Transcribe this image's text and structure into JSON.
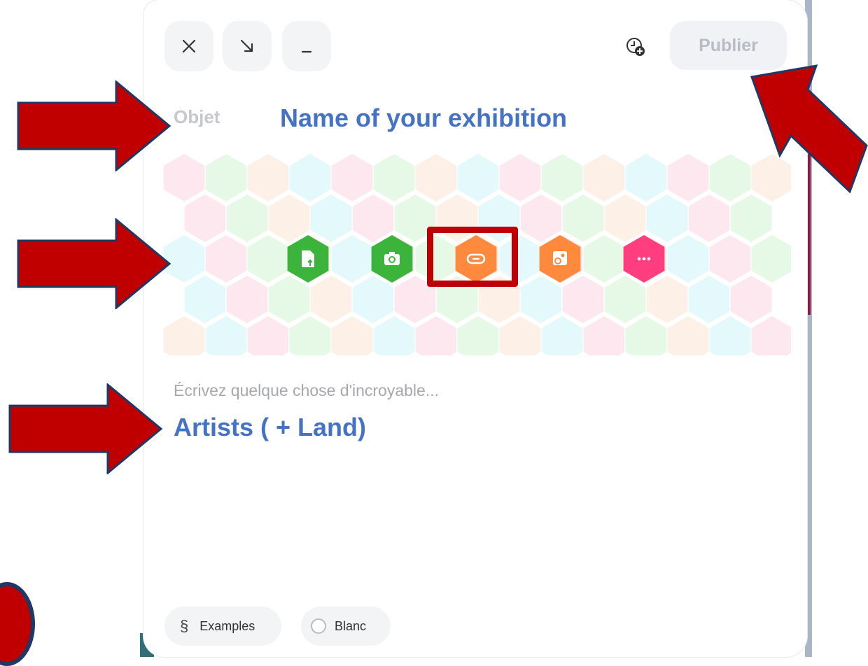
{
  "toolbar": {
    "close_icon": "close-icon",
    "shrink_icon": "arrow-down-right-icon",
    "minimize_icon": "minimize-icon",
    "schedule_icon": "clock-plus-icon",
    "publish_label": "Publier"
  },
  "form": {
    "subject_placeholder": "Objet",
    "body_placeholder": "Écrivez quelque chose d'incroyable..."
  },
  "annotations": {
    "title_note": "Name of your exhibition",
    "body_note": "Artists ( + Land)"
  },
  "media_buttons": [
    {
      "name": "upload-file-button",
      "icon": "file-upload-icon",
      "color": "#3cb43c"
    },
    {
      "name": "camera-button",
      "icon": "camera-icon",
      "color": "#3cb43c"
    },
    {
      "name": "link-button",
      "icon": "link-icon",
      "color": "#ff8a3d"
    },
    {
      "name": "image-search-button",
      "icon": "image-search-icon",
      "color": "#ff8a3d"
    },
    {
      "name": "more-button",
      "icon": "more-icon",
      "color": "#ff3d7f"
    }
  ],
  "footer": {
    "examples_label": "Examples",
    "examples_icon": "section-icon",
    "blank_label": "Blanc"
  },
  "colors": {
    "accent_text": "#4472c4",
    "arrow_fill": "#c00000",
    "arrow_stroke": "#1f3864"
  }
}
